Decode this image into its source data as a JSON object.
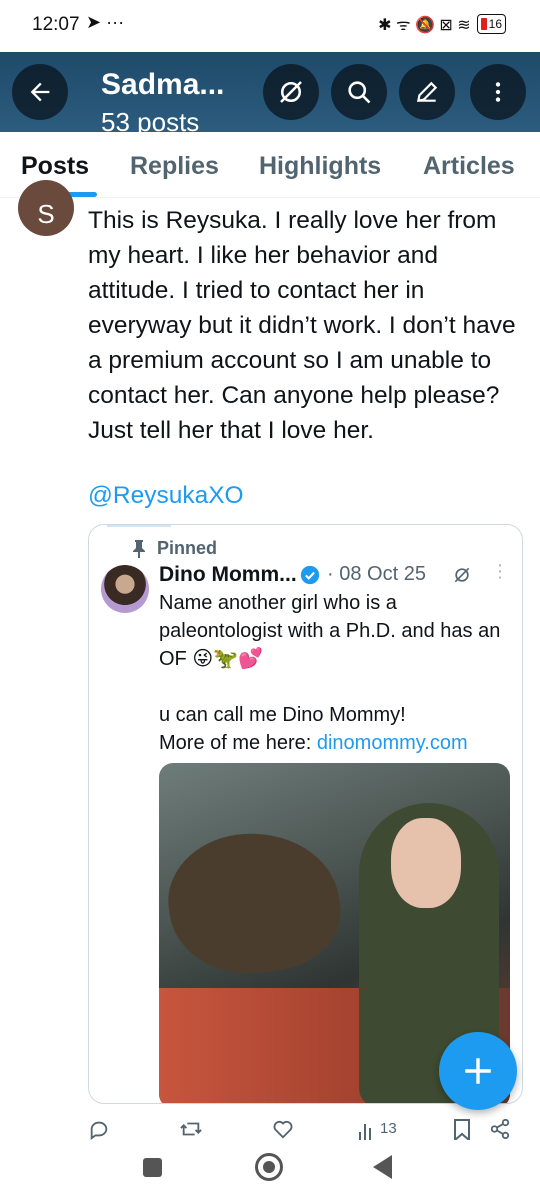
{
  "status_bar": {
    "time": "12:07",
    "left_icons": "➤ ···",
    "right_icons": "✱ ᯤ 🔕 ⊠ ≋",
    "battery": "16"
  },
  "header": {
    "title": "Sadma...",
    "subtitle": "53 posts",
    "background": "#1f4a6a"
  },
  "tabs": [
    {
      "label": "Posts",
      "active": true
    },
    {
      "label": "Replies",
      "active": false
    },
    {
      "label": "Highlights",
      "active": false
    },
    {
      "label": "Articles",
      "active": false
    }
  ],
  "post": {
    "avatar_letter": "S",
    "text": "This is Reysuka.  I really love her from my heart.  I like her behavior and attitude.  I tried to contact her in everyway but it didn’t work.  I don’t have a premium account so I am unable to contact her.  Can anyone help please?  Just tell her that I love her.",
    "mention": "@ReysukaXO"
  },
  "quote": {
    "pinned_label": "Pinned",
    "name": "Dino Momm...",
    "date": "· 08 Oct 25",
    "line1": "Name another girl who is a paleontologist with a Ph.D. and has an OF 😜🦖💕",
    "line2": "u can call me Dino Mommy!",
    "line3_prefix": "More of me here: ",
    "line3_link": "dinomommy.com"
  },
  "actions": {
    "views": "13"
  },
  "colors": {
    "accent": "#1d9bf0",
    "text": "#0f1419",
    "secondary": "#536471"
  }
}
